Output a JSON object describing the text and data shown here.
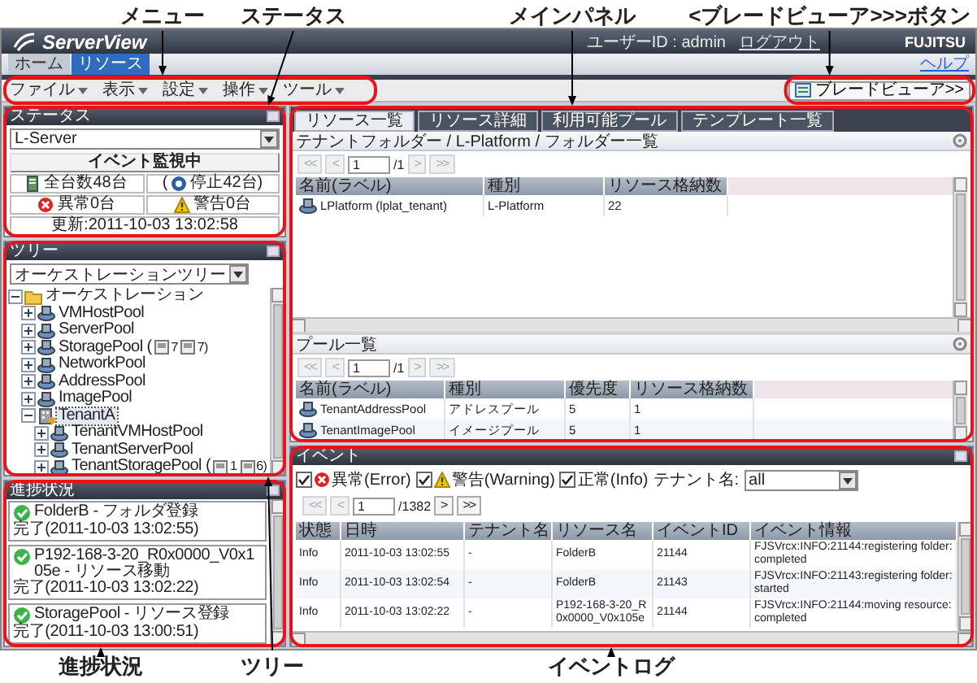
{
  "callouts_top": {
    "menu": "メニュー",
    "status": "ステータス",
    "main": "メインパネル",
    "blade": "<ブレードビューア>>>ボタン"
  },
  "callouts_bottom": {
    "progress": "進捗状況",
    "tree": "ツリー",
    "events": "イベントログ"
  },
  "header": {
    "logo": "ServerView",
    "user": "ユーザーID : admin",
    "logout": "ログアウト",
    "brand": "FUJITSU"
  },
  "nav_tabs": [
    {
      "label": "ホーム",
      "selected": false
    },
    {
      "label": "リソース",
      "selected": true
    }
  ],
  "help_link": "ヘルプ",
  "menu": {
    "items": [
      "ファイル",
      "表示",
      "設定",
      "操作",
      "ツール"
    ],
    "blade_viewer_button": "ブレードビューア>>"
  },
  "status_panel": {
    "title": "ステータス",
    "selector": "L-Server",
    "monitor": "イベント監視中",
    "total": "全台数48台",
    "stopped_open": "(",
    "stopped": "停止42台)",
    "error": "異常0台",
    "warning": "警告0台",
    "updated": "更新:2011-10-03 13:02:58"
  },
  "tree_panel": {
    "title": "ツリー",
    "selector": "オーケストレーションツリー",
    "root": {
      "label": "オーケストレーション",
      "kind": "folder",
      "expanded": true,
      "selected": false,
      "children": [
        {
          "label": "VMHostPool",
          "kind": "pool",
          "expanded": false,
          "selected": false
        },
        {
          "label": "ServerPool",
          "kind": "pool",
          "expanded": false,
          "selected": false
        },
        {
          "label": "StoragePool (",
          "kind": "pool",
          "expanded": false,
          "selected": false,
          "counts": [
            "7",
            "7)"
          ]
        },
        {
          "label": "NetworkPool",
          "kind": "pool",
          "expanded": false,
          "selected": false
        },
        {
          "label": "AddressPool",
          "kind": "pool",
          "expanded": false,
          "selected": false
        },
        {
          "label": "ImagePool",
          "kind": "pool",
          "expanded": false,
          "selected": false
        },
        {
          "label": "TenantA",
          "kind": "tenant",
          "expanded": true,
          "selected": true,
          "children": [
            {
              "label": "TenantVMHostPool",
              "kind": "pool",
              "expanded": false,
              "selected": false
            },
            {
              "label": "TenantServerPool",
              "kind": "pool",
              "expanded": false,
              "selected": false
            },
            {
              "label": "TenantStoragePool (",
              "kind": "pool",
              "expanded": false,
              "selected": false,
              "counts": [
                "1",
                "6)"
              ]
            }
          ]
        }
      ]
    }
  },
  "progress_panel": {
    "title": "進捗状況",
    "items": [
      {
        "name": "FolderB - フォルダ登録",
        "status": "完了(2011-10-03 13:02:55)"
      },
      {
        "name": "P192-168-3-20_R0x0000_V0x105e - リソース移動",
        "status": "完了(2011-10-03 13:02:22)"
      },
      {
        "name": "StoragePool - リソース登録",
        "status": "完了(2011-10-03 13:00:51)"
      }
    ]
  },
  "main_panel": {
    "tabs": [
      {
        "label": "リソース一覧",
        "selected": true
      },
      {
        "label": "リソース詳細",
        "selected": false
      },
      {
        "label": "利用可能プール",
        "selected": false
      },
      {
        "label": "テンプレート一覧",
        "selected": false
      }
    ],
    "folder_list": {
      "title": "テナントフォルダー / L-Platform / フォルダー一覧",
      "pager": {
        "buttons": [
          {
            "label": "<<",
            "disabled": true
          },
          {
            "label": "<",
            "disabled": true
          },
          {
            "label": ">",
            "disabled": true
          },
          {
            "label": ">>",
            "disabled": true
          }
        ],
        "page": "1",
        "total": "/1"
      },
      "columns": [
        "名前(ラベル)",
        "種別",
        "リソース格納数"
      ],
      "rows": [
        [
          "LPlatform (lplat_tenant)",
          "L-Platform",
          "22"
        ]
      ]
    },
    "pool_list": {
      "title": "プール一覧",
      "pager": {
        "buttons": [
          {
            "label": "<<",
            "disabled": true
          },
          {
            "label": "<",
            "disabled": true
          },
          {
            "label": ">",
            "disabled": true
          },
          {
            "label": ">>",
            "disabled": true
          }
        ],
        "page": "1",
        "total": "/1"
      },
      "columns": [
        "名前(ラベル)",
        "種別",
        "優先度",
        "リソース格納数"
      ],
      "rows": [
        [
          "TenantAddressPool",
          "アドレスプール",
          "5",
          "1"
        ],
        [
          "TenantImagePool",
          "イメージプール",
          "5",
          "1"
        ]
      ]
    }
  },
  "event_panel": {
    "title": "イベント",
    "filters": [
      {
        "label": "異常(Error)",
        "kind": "error",
        "checked": true
      },
      {
        "label": "警告(Warning)",
        "kind": "warning",
        "checked": true
      },
      {
        "label": "正常(Info)",
        "kind": "info",
        "checked": true
      }
    ],
    "tenant_label": "テナント名:",
    "tenant_value": "all",
    "pager": {
      "buttons": [
        {
          "label": "<<",
          "disabled": true
        },
        {
          "label": "<",
          "disabled": true
        },
        {
          "label": ">",
          "disabled": false
        },
        {
          "label": ">>",
          "disabled": false
        }
      ],
      "page": "1",
      "total": "/1382"
    },
    "columns": [
      "状態",
      "日時",
      "テナント名",
      "リソース名",
      "イベントID",
      "イベント情報"
    ],
    "rows": [
      [
        "Info",
        "2011-10-03 13:02:55",
        "-",
        "FolderB",
        "21144",
        "FJSVrcx:INFO:21144:registering folder:completed"
      ],
      [
        "Info",
        "2011-10-03 13:02:54",
        "-",
        "FolderB",
        "21143",
        "FJSVrcx:INFO:21143:registering folder:started"
      ],
      [
        "Info",
        "2011-10-03 13:02:22",
        "-",
        "P192-168-3-20_R0x0000_V0x105e",
        "21144",
        "FJSVrcx:INFO:21144:moving resource:completed"
      ]
    ]
  }
}
